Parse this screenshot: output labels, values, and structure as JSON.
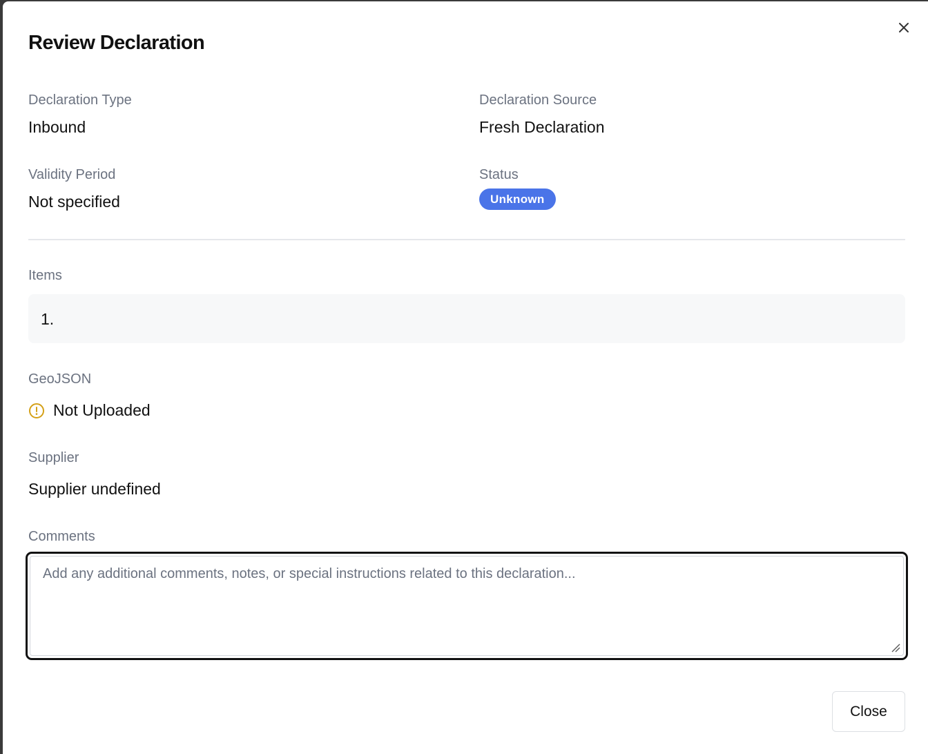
{
  "dialog": {
    "title": "Review Declaration",
    "close_icon": "close-icon"
  },
  "details": {
    "declaration_type": {
      "label": "Declaration Type",
      "value": "Inbound"
    },
    "declaration_source": {
      "label": "Declaration Source",
      "value": "Fresh Declaration"
    },
    "validity_period": {
      "label": "Validity Period",
      "value": "Not specified"
    },
    "status": {
      "label": "Status",
      "value": "Unknown",
      "badge_color": "#4a74e8"
    }
  },
  "items": {
    "label": "Items",
    "list": [
      {
        "number": "1.",
        "name": ""
      }
    ]
  },
  "geojson": {
    "label": "GeoJSON",
    "status": "Not Uploaded",
    "icon": "warning-circle-icon",
    "icon_color": "#d4a017"
  },
  "supplier": {
    "label": "Supplier",
    "value": "Supplier undefined"
  },
  "comments": {
    "label": "Comments",
    "value": "",
    "placeholder": "Add any additional comments, notes, or special instructions related to this declaration..."
  },
  "footer": {
    "close_label": "Close"
  }
}
